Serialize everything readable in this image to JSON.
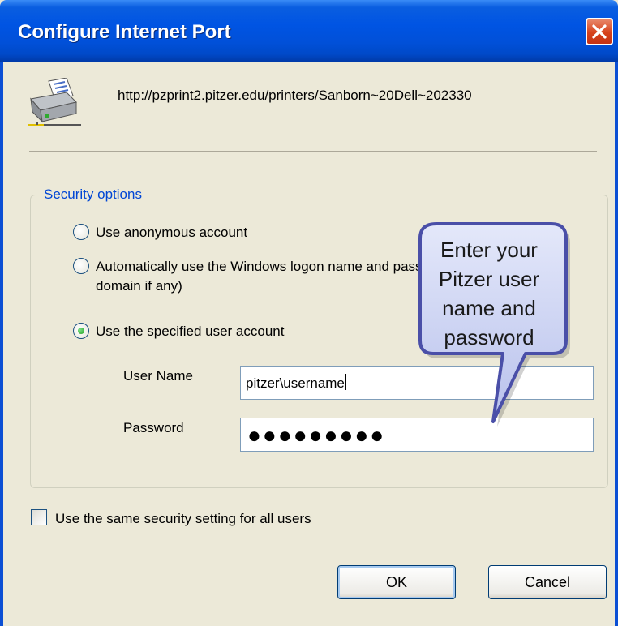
{
  "window": {
    "title": "Configure Internet Port"
  },
  "printer": {
    "url": "http://pzprint2.pitzer.edu/printers/Sanborn~20Dell~202330",
    "icon": "printer-icon"
  },
  "security": {
    "group_label": "Security options",
    "options": [
      {
        "label": "Use anonymous account",
        "checked": false
      },
      {
        "label_line1": "Automatically use the Windows logon name and password (and",
        "label_line2": "domain if any)",
        "checked": false
      },
      {
        "label": "Use the specified user account",
        "checked": true
      }
    ],
    "username_label": "User Name",
    "username_value": "pitzer\\username",
    "password_label": "Password",
    "password_value": "●●●●●●●●●"
  },
  "checkbox": {
    "label": "Use the same security setting for all users",
    "checked": false
  },
  "buttons": {
    "ok": "OK",
    "cancel": "Cancel"
  },
  "callout": {
    "line1": "Enter your",
    "line2": "Pitzer user",
    "line3": "name and",
    "line4": "password"
  },
  "colors": {
    "title_bar": "#0054e3",
    "dialog_bg": "#ece9d8",
    "group_label": "#0046d5",
    "callout_fill": "#cfd6f4",
    "close_button": "#d6421c"
  }
}
